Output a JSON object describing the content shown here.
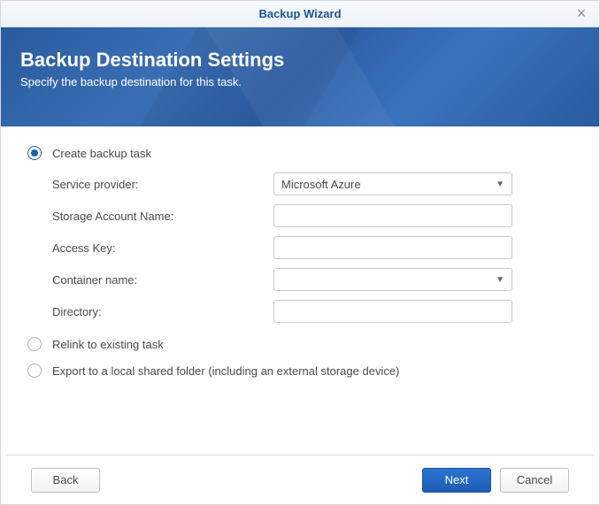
{
  "titlebar": {
    "title": "Backup Wizard"
  },
  "header": {
    "title": "Backup Destination Settings",
    "subtitle": "Specify the backup destination for this task."
  },
  "options": {
    "create": {
      "label": "Create backup task",
      "selected": true
    },
    "relink": {
      "label": "Relink to existing task",
      "selected": false
    },
    "export": {
      "label": "Export to a local shared folder (including an external storage device)",
      "selected": false
    }
  },
  "form": {
    "service_provider": {
      "label": "Service provider:",
      "value": "Microsoft Azure"
    },
    "storage_account": {
      "label": "Storage Account Name:",
      "value": ""
    },
    "access_key": {
      "label": "Access Key:",
      "value": ""
    },
    "container_name": {
      "label": "Container name:",
      "value": ""
    },
    "directory": {
      "label": "Directory:",
      "value": ""
    }
  },
  "footer": {
    "back": "Back",
    "next": "Next",
    "cancel": "Cancel"
  }
}
